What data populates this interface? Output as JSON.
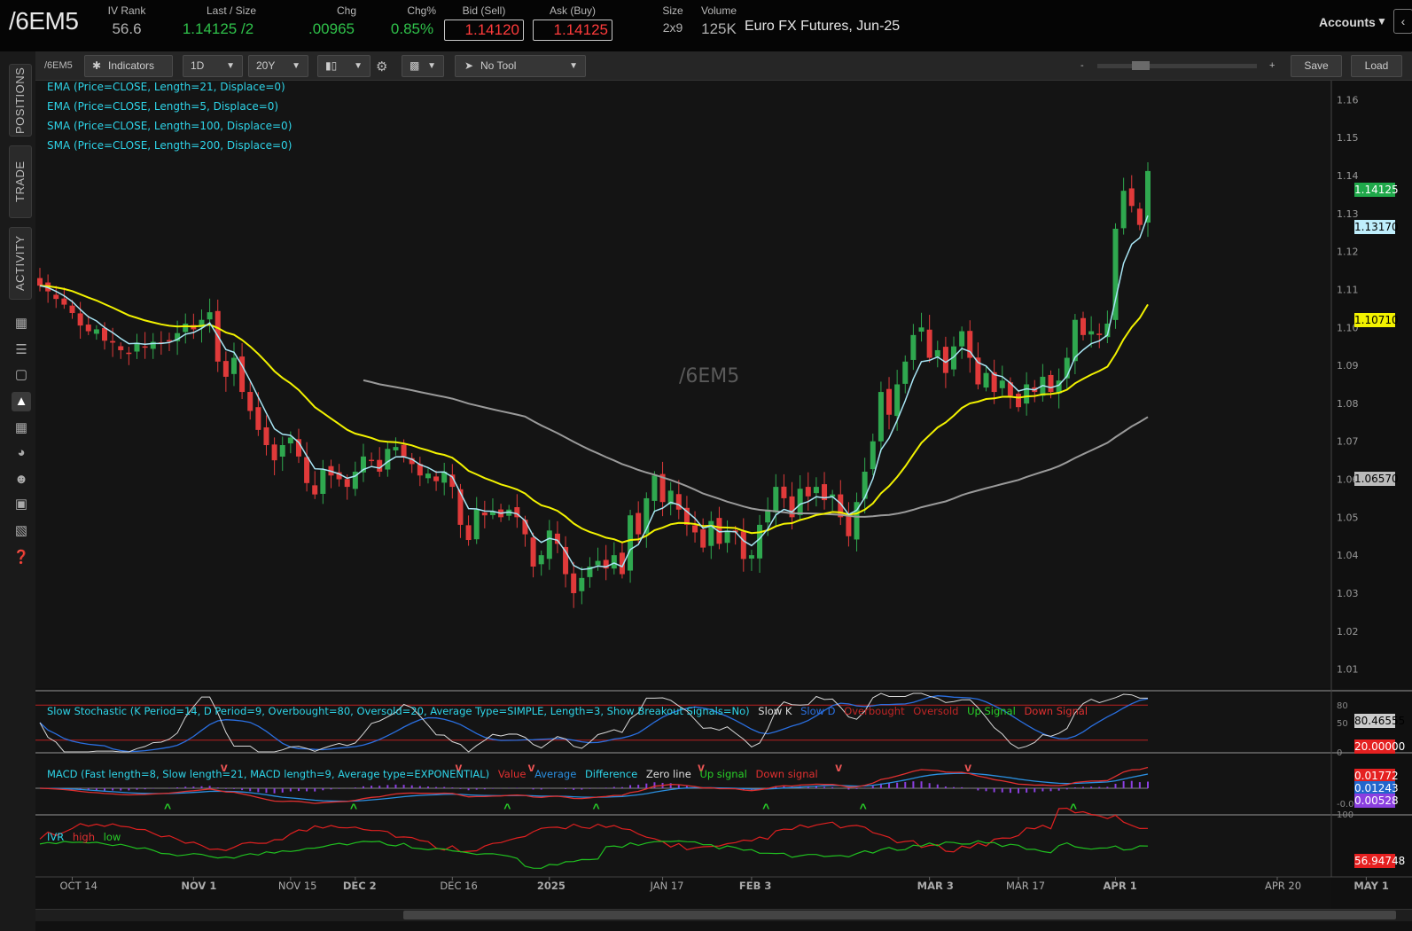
{
  "quote": {
    "symbol": "/6EM5",
    "iv_rank_label": "IV Rank",
    "iv_rank": "56.6",
    "last_size_label": "Last / Size",
    "last_size": "1.14125 /2",
    "chg_label": "Chg",
    "chg": ".00965",
    "chgpct_label": "Chg%",
    "chgpct": "0.85%",
    "bid_label": "Bid (Sell)",
    "bid": "1.14120",
    "ask_label": "Ask (Buy)",
    "ask": "1.14125",
    "size_label": "Size",
    "size": "2x9",
    "volume_label": "Volume",
    "volume": "125K",
    "description": "Euro FX Futures, Jun-25",
    "accounts": "Accounts"
  },
  "sidebar": {
    "tabs": [
      "POSITIONS",
      "TRADE",
      "ACTIVITY"
    ],
    "icons": [
      "news-icon",
      "list-icon",
      "tv-icon",
      "chart-icon",
      "grid-icon",
      "gauge-icon",
      "people-icon",
      "ticket-icon",
      "calc-icon",
      "help-icon"
    ]
  },
  "toolbar": {
    "symbol": "/6EM5",
    "indicators": "Indicators",
    "interval": "1D",
    "range": "20Y",
    "tool": "No Tool",
    "zoom_minus": "-",
    "zoom_plus": "+",
    "save": "Save",
    "load": "Load"
  },
  "studies": {
    "ema21": "EMA (Price=CLOSE, Length=21, Displace=0)",
    "ema5": "EMA (Price=CLOSE, Length=5, Displace=0)",
    "sma100": "SMA (Price=CLOSE, Length=100, Displace=0)",
    "sma200": "SMA (Price=CLOSE, Length=200, Displace=0)",
    "stoch": "Slow Stochastic (K Period=14, D Period=9, Overbought=80, Oversold=20, Average Type=SIMPLE, Length=3, Show Breakout Signals=No)",
    "stoch_legend": [
      "Slow K",
      "Slow D",
      "Overbought",
      "Oversold",
      "Up Signal",
      "Down Signal"
    ],
    "macd": "MACD (Fast length=8, Slow length=21, MACD length=9, Average type=EXPONENTIAL)",
    "macd_legend": [
      "Value",
      "Average",
      "Difference",
      "Zero line",
      "Up signal",
      "Down signal"
    ],
    "ivr": "IVR",
    "ivr_legend": [
      "high",
      "low"
    ]
  },
  "watermark": "/6EM5",
  "price_tags": {
    "last": "1.14125",
    "ema5": "1.13170",
    "ema21": "1.10710",
    "sma100": "1.06570",
    "stoch_k": "80.46555",
    "stoch_os": "20.00000",
    "macd_val": "0.01772",
    "macd_avg": "0.01243",
    "macd_diff": "0.00528",
    "ivr_val": "56.94748"
  },
  "colors": {
    "up": "#2fa84f",
    "down": "#e03a3a",
    "ema5": "#a8e6f5",
    "ema21": "#f2f200",
    "sma100": "#9a9a9a",
    "studytext": "#2ed4e8"
  },
  "chart_data": {
    "type": "candlestick",
    "title": "/6EM5",
    "ylim": [
      1.005,
      1.165
    ],
    "yticks": [
      1.16,
      1.15,
      1.14,
      1.13,
      1.12,
      1.11,
      1.1,
      1.09,
      1.08,
      1.07,
      1.06,
      1.05,
      1.04,
      1.03,
      1.02,
      1.01
    ],
    "xticks": [
      "OCT 14",
      "NOV 1",
      "NOV 15",
      "DEC 2",
      "DEC 16",
      "2025",
      "JAN 17",
      "FEB 3",
      "MAR 3",
      "MAR 17",
      "APR 1",
      "APR 20",
      "MAY 1"
    ],
    "close": [
      1.111,
      1.1095,
      1.1075,
      1.106,
      1.1038,
      1.1005,
      1.099,
      1.0995,
      1.0965,
      1.096,
      1.094,
      1.093,
      1.096,
      1.095,
      1.0962,
      1.0958,
      1.0965,
      1.0985,
      1.101,
      1.0995,
      1.102,
      1.104,
      1.091,
      1.087,
      1.092,
      1.083,
      1.078,
      1.073,
      1.069,
      1.065,
      1.069,
      1.071,
      1.066,
      1.059,
      1.056,
      1.0625,
      1.061,
      1.06,
      1.058,
      1.062,
      1.066,
      1.065,
      1.062,
      1.068,
      1.0685,
      1.066,
      1.064,
      1.061,
      1.0615,
      1.0595,
      1.062,
      1.058,
      1.048,
      1.044,
      1.052,
      1.0505,
      1.0515,
      1.05,
      1.052,
      1.05,
      1.0455,
      1.037,
      1.04,
      1.0465,
      1.043,
      1.035,
      1.03,
      1.034,
      1.037,
      1.0385,
      1.0365,
      1.04,
      1.035,
      1.0505,
      1.0455,
      1.055,
      1.061,
      1.054,
      1.057,
      1.052,
      1.048,
      1.046,
      1.042,
      1.049,
      1.043,
      1.0465,
      1.046,
      1.039,
      1.04,
      1.048,
      1.052,
      1.058,
      1.055,
      1.05,
      1.0575,
      1.0555,
      1.058,
      1.0545,
      1.056,
      1.05,
      1.045,
      1.054,
      1.062,
      1.07,
      1.083,
      1.077,
      1.085,
      1.091,
      1.098,
      1.1,
      1.092,
      1.094,
      1.088,
      1.095,
      1.099,
      1.092,
      1.085,
      1.088,
      1.083,
      1.086,
      1.082,
      1.079,
      1.085,
      1.083,
      1.087,
      1.083,
      1.086,
      1.092,
      1.102,
      1.098,
      1.099,
      1.098,
      1.101,
      1.126,
      1.136,
      1.132,
      1.127,
      1.1412
    ]
  }
}
